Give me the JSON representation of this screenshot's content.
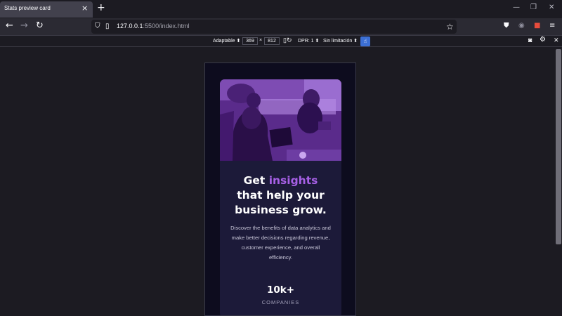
{
  "browser": {
    "tab_title": "Stats preview card",
    "tab_close": "×",
    "new_tab": "+",
    "url_host": "127.0.0.1",
    "url_rest": ":5500/index.html",
    "icons": {
      "back": "back-arrow-icon",
      "forward": "forward-arrow-icon",
      "reload": "reload-icon",
      "shield": "shield-icon",
      "page": "page-icon",
      "star": "bookmark-star-icon",
      "pocket": "pocket-icon",
      "account": "account-icon",
      "extension": "extension-icon",
      "menu": "hamburger-menu-icon"
    }
  },
  "rdm": {
    "device": "Adaptable ⬍",
    "width": "369",
    "times": "×",
    "height": "812",
    "dpr": "DPR: 1 ⬍",
    "throttle": "Sin limitación ⬍"
  },
  "card": {
    "heading_part1": "Get",
    "heading_accent": "insights",
    "heading_line2": "that help your",
    "heading_line3": "business grow.",
    "description": "Discover the benefits of data analytics and make better decisions regarding revenue, customer experience, and overall efficiency.",
    "stat_value": "10k+",
    "stat_label": "COMPANIES"
  },
  "colors": {
    "page_bg": "#0d0c1e",
    "card_bg": "#1c1a39",
    "accent": "#a760e6",
    "hero_tint": "#5b2a8c"
  }
}
